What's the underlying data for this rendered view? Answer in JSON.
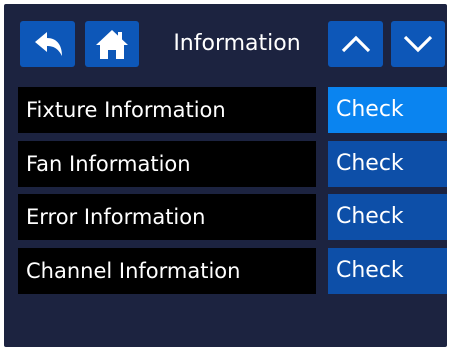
{
  "header": {
    "title": "Information",
    "back_icon": "back-arrow-icon",
    "home_icon": "home-icon",
    "up_icon": "chevron-up-icon",
    "down_icon": "chevron-down-icon"
  },
  "rows": [
    {
      "label": "Fixture Information",
      "action": "Check",
      "selected": true
    },
    {
      "label": "Fan Information",
      "action": "Check",
      "selected": false
    },
    {
      "label": "Error Information",
      "action": "Check",
      "selected": false
    },
    {
      "label": "Channel Information",
      "action": "Check",
      "selected": false
    }
  ],
  "colors": {
    "background": "#1c2340",
    "button": "#0d4fa8",
    "button_selected": "#0a84f0",
    "label_background": "#000000"
  }
}
